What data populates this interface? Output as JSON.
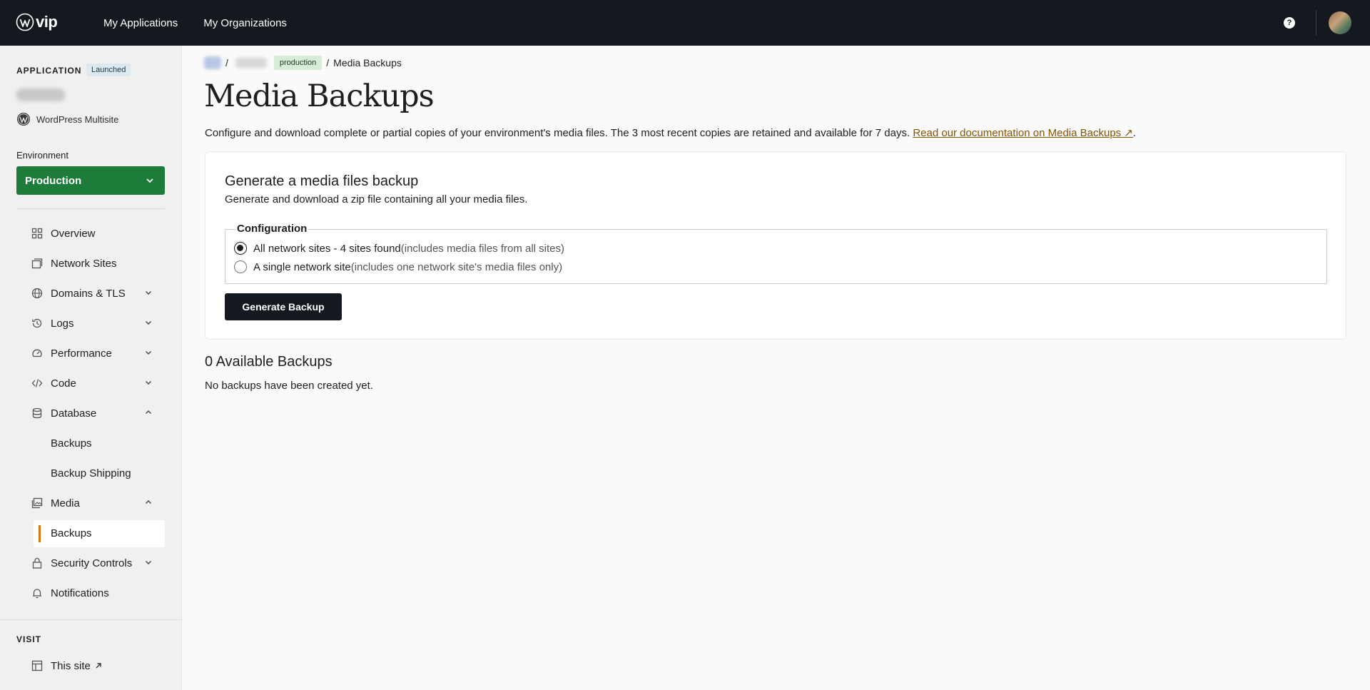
{
  "topbar": {
    "logo_text": "vip",
    "nav": [
      "My Applications",
      "My Organizations"
    ],
    "help_glyph": "?"
  },
  "sidebar": {
    "application_label": "APPLICATION",
    "status_badge": "Launched",
    "app_type": "WordPress Multisite",
    "environment_label": "Environment",
    "environment_value": "Production",
    "items": [
      {
        "label": "Overview",
        "icon": "grid-icon"
      },
      {
        "label": "Network Sites",
        "icon": "windows-icon"
      },
      {
        "label": "Domains & TLS",
        "icon": "globe-icon"
      },
      {
        "label": "Logs",
        "icon": "history-icon"
      },
      {
        "label": "Performance",
        "icon": "gauge-icon"
      },
      {
        "label": "Code",
        "icon": "code-icon"
      },
      {
        "label": "Database",
        "icon": "database-icon"
      },
      {
        "label": "Media",
        "icon": "media-icon"
      },
      {
        "label": "Security Controls",
        "icon": "lock-icon"
      },
      {
        "label": "Notifications",
        "icon": "bell-icon"
      }
    ],
    "database_sub": [
      "Backups",
      "Backup Shipping"
    ],
    "media_sub": [
      "Backups"
    ],
    "visit_label": "VISIT",
    "this_site": "This site"
  },
  "breadcrumb": {
    "sep": "/",
    "env_tag": "production",
    "current": "Media Backups"
  },
  "main": {
    "title": "Media Backups",
    "description": "Configure and download complete or partial copies of your environment's media files. The 3 most recent copies are retained and available for 7 days. ",
    "doc_link": "Read our documentation on Media Backups ↗",
    "desc_end": ".",
    "card": {
      "title": "Generate a media files backup",
      "subtitle": "Generate and download a zip file containing all your media files.",
      "legend": "Configuration",
      "options": [
        {
          "label": "All network sites - 4 sites found",
          "hint": "(includes media files from all sites)",
          "checked": true
        },
        {
          "label": "A single network site",
          "hint": "(includes one network site's media files only)",
          "checked": false
        }
      ],
      "button": "Generate Backup"
    },
    "available_title": "0 Available Backups",
    "available_empty": "No backups have been created yet."
  },
  "colors": {
    "topbar": "#13191e",
    "environment": "#1e7c3a",
    "active_accent": "#d67709",
    "link": "#8a5300"
  }
}
